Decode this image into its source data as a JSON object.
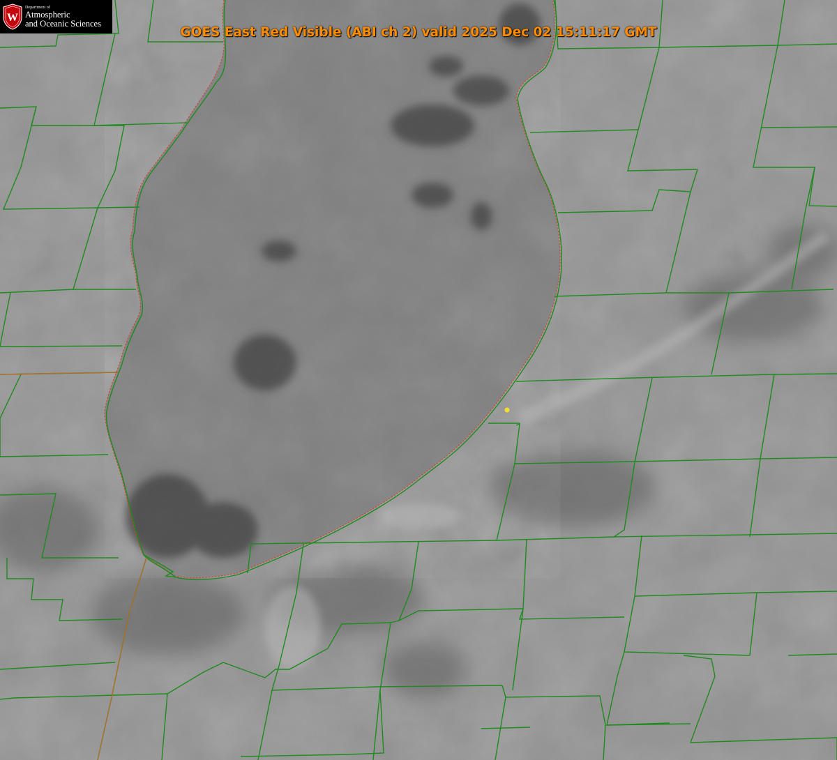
{
  "title": "GOES East Red Visible (ABI ch 2) valid 2025 Dec 02 15:11:17 GMT",
  "logo": {
    "department": "Department of",
    "line1": "Atmospheric",
    "line2": "and Oceanic Sciences",
    "seal_letter": "W"
  },
  "colors": {
    "background": "#8f8f8f",
    "lake": "#7d7d7d",
    "boundaries": "#1f8a1f",
    "shoreline_outline": "#e03a2a",
    "title": "#ff8c00",
    "marker": "#f0e030",
    "logo_bg": "#000000",
    "seal": "#c5050c"
  },
  "map_layers": [
    "county-boundaries",
    "lake-shoreline",
    "cloud-texture",
    "point-marker"
  ]
}
